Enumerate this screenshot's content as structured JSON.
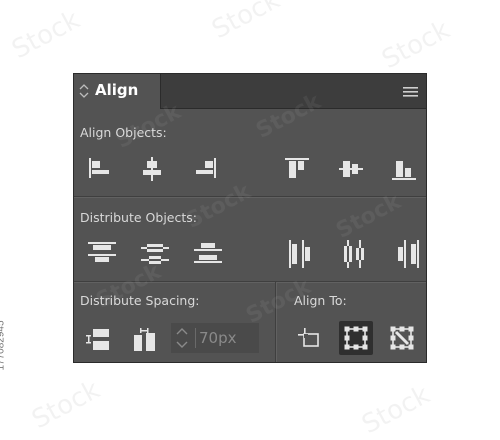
{
  "panel": {
    "title": "Align",
    "menu_icon": "hamburger-menu-icon",
    "tab_icon": "collapse-arrows-icon"
  },
  "align_objects": {
    "label": "Align Objects:",
    "buttons": [
      "align-left-edges-icon",
      "align-horizontal-centers-icon",
      "align-right-edges-icon",
      "align-top-edges-icon",
      "align-vertical-centers-icon",
      "align-bottom-edges-icon"
    ]
  },
  "distribute_objects": {
    "label": "Distribute Objects:",
    "buttons": [
      "distribute-top-edges-icon",
      "distribute-vertical-centers-icon",
      "distribute-bottom-edges-icon",
      "distribute-left-edges-icon",
      "distribute-horizontal-centers-icon",
      "distribute-right-edges-icon"
    ]
  },
  "distribute_spacing": {
    "label": "Distribute Spacing:",
    "buttons": [
      "vertical-distribute-space-icon",
      "horizontal-distribute-space-icon"
    ],
    "field_placeholder": "70px",
    "stepper_icon": "up-down-stepper-icon"
  },
  "align_to": {
    "label": "Align To:",
    "buttons": [
      "align-to-artboard-icon",
      "align-to-selection-icon",
      "align-to-key-object-icon"
    ],
    "selected": "align-to-selection-icon"
  },
  "watermark": {
    "stock_text": "Stock",
    "image_id": "177082945"
  },
  "colors": {
    "panel_bg": "#535353",
    "tabstrip_bg": "#3d3d3d",
    "icon": "#e6e6e6",
    "label": "#d9d9d9",
    "selected_bg": "#2f2f2f"
  }
}
